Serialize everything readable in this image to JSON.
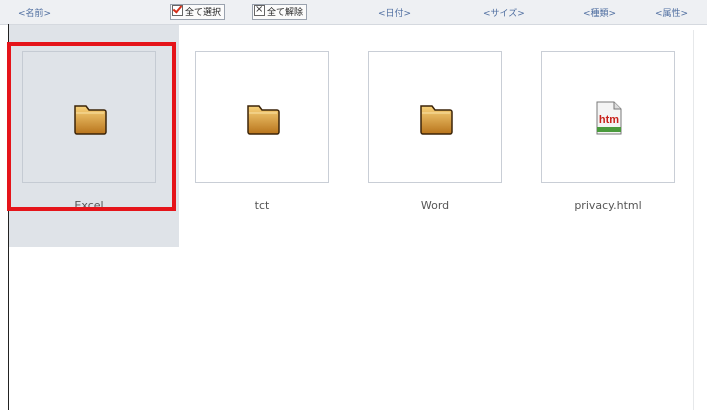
{
  "toolbar": {
    "sort_name": "<名前>",
    "select_all": "全て選択",
    "deselect_all": "全て解除",
    "sort_date": "<日付>",
    "sort_size": "<サイズ>",
    "sort_type": "<種類>",
    "sort_attr": "<属性>"
  },
  "files": [
    {
      "name": "Excel",
      "icon": "folder-icon",
      "selected": true
    },
    {
      "name": "tct",
      "icon": "folder-icon",
      "selected": false
    },
    {
      "name": "Word",
      "icon": "folder-icon",
      "selected": false
    },
    {
      "name": "privacy.html",
      "icon": "html-file-icon",
      "selected": false
    }
  ],
  "colors": {
    "selection": "#e5141a",
    "selected_bg": "#dfe3e8",
    "link": "#4f6ea0"
  }
}
